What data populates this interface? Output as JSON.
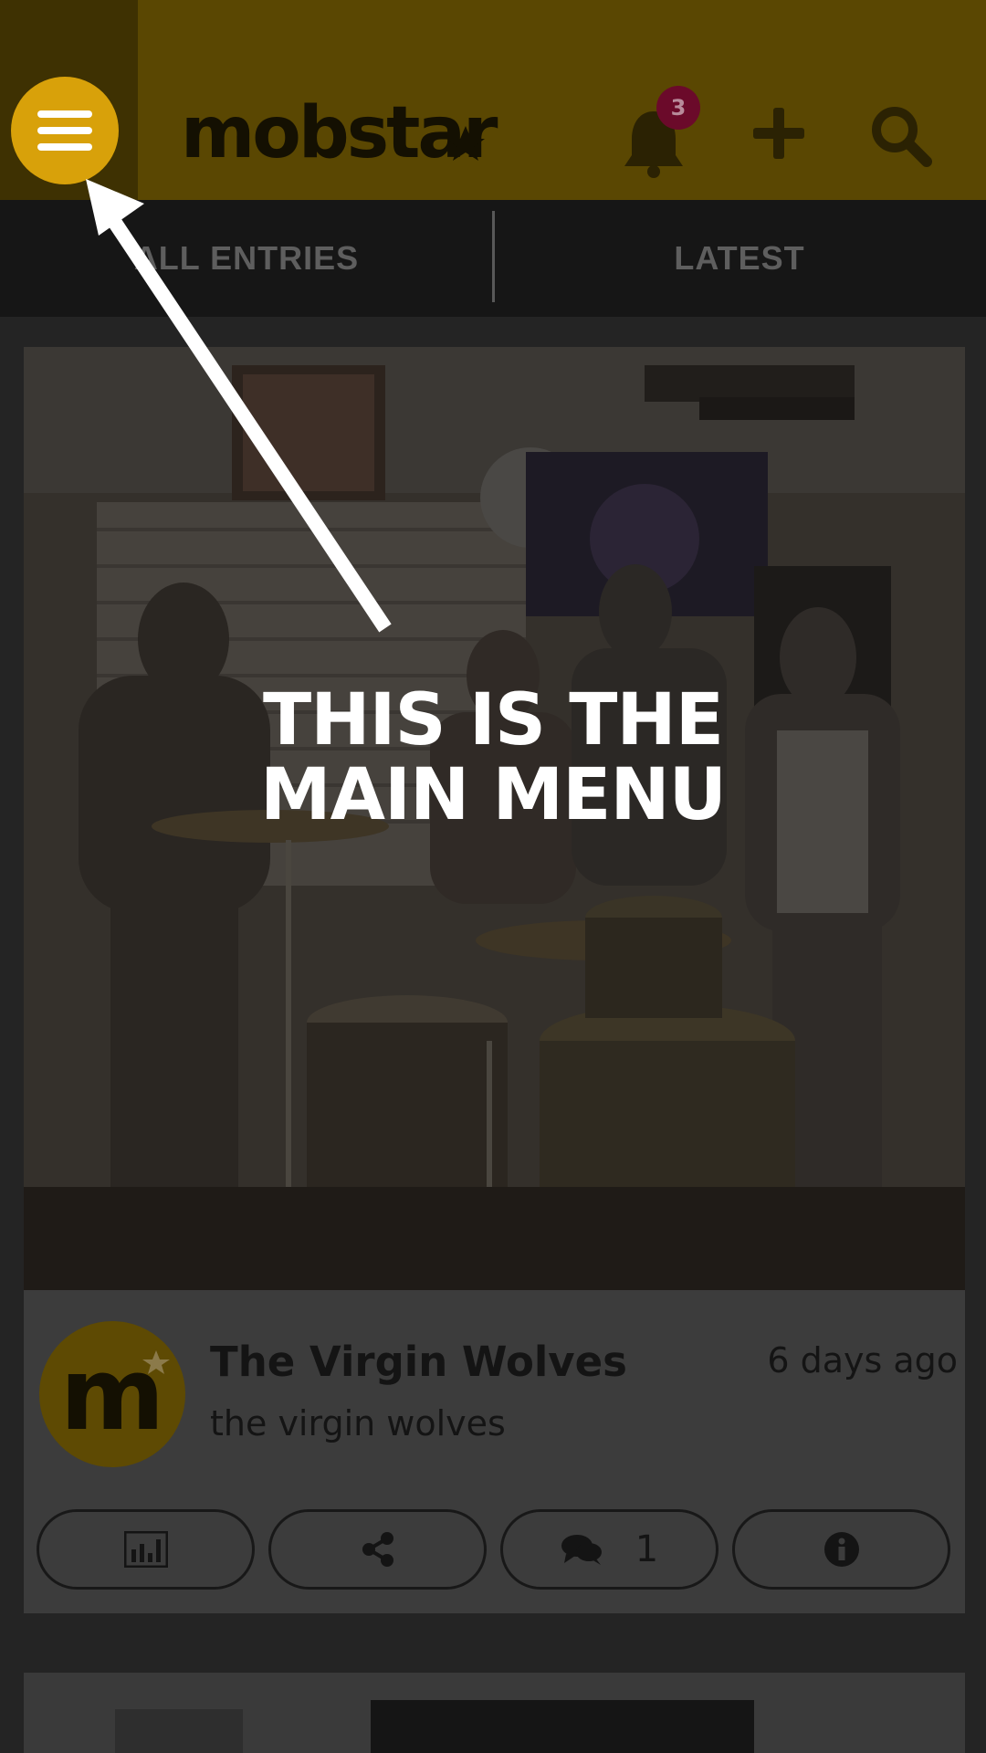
{
  "header": {
    "logo_text": "mobstar",
    "notification_count": "3",
    "icons": [
      "menu-icon",
      "bell-icon",
      "plus-icon",
      "search-icon"
    ]
  },
  "tabs": [
    {
      "label": "ALL ENTRIES"
    },
    {
      "label": "LATEST"
    }
  ],
  "entry": {
    "title": "The Virgin Wolves",
    "subtitle": "the virgin wolves",
    "time": "6 days ago",
    "avatar_letter": "m",
    "actions": {
      "stats_icon": "bar-chart-icon",
      "share_icon": "share-icon",
      "comment_icon": "comment-icon",
      "comment_count": "1",
      "info_icon": "info-icon"
    }
  },
  "overlay": {
    "line1": "THIS IS THE",
    "line2": "MAIN MENU"
  },
  "colors": {
    "brand_yellow": "#d8a10a",
    "header_dimmed": "#5a4702",
    "badge": "#6b0a2a"
  }
}
